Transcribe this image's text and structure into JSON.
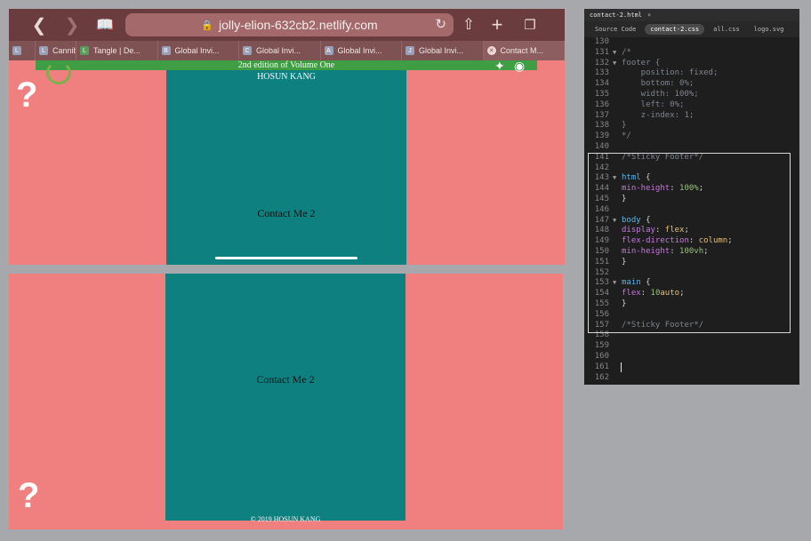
{
  "browser": {
    "url": "jolly-elion-632cb2.netlify.com",
    "tabs": [
      {
        "icon": "L",
        "label": ""
      },
      {
        "icon": "L",
        "label": "Cannib"
      },
      {
        "icon": "L",
        "label": "Tangle | De..."
      },
      {
        "icon": "B",
        "label": "Global Invi..."
      },
      {
        "icon": "C",
        "label": "Global Invi..."
      },
      {
        "icon": "A",
        "label": "Global Invi..."
      },
      {
        "icon": "J",
        "label": "Global Invi..."
      },
      {
        "icon": "✕",
        "label": "Contact M..."
      }
    ]
  },
  "site_top": {
    "banner": "2nd edition of Volume One",
    "author": "HOSUN KANG",
    "contact": "Contact Me 2",
    "qmark": "?"
  },
  "site_bottom": {
    "contact": "Contact Me 2",
    "footer": "© 2019 HOSUN KANG",
    "qmark": "?"
  },
  "editor": {
    "window_tab": "contact-2.html",
    "files": [
      "Source Code",
      "contact-2.css",
      "all.css",
      "logo.svg"
    ],
    "active_file": "contact-2.css"
  },
  "colors": {
    "page_bg": "#f08080",
    "teal": "#0e8080",
    "banner": "#3f9e43"
  }
}
